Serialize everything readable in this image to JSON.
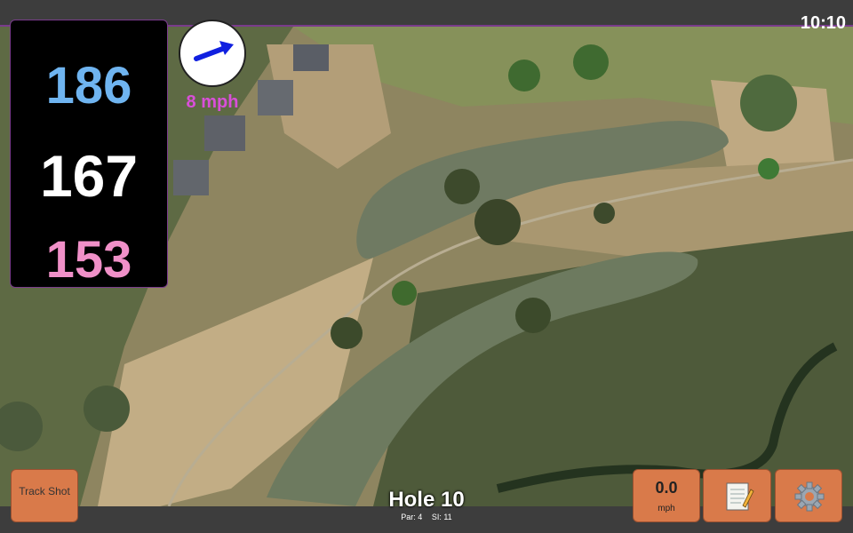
{
  "status": {
    "time": "10:10"
  },
  "distances": {
    "back": "186",
    "middle": "167",
    "front": "153"
  },
  "wind": {
    "speed_label": "8 mph",
    "icon": "wind-arrow-icon"
  },
  "buttons": {
    "track_shot": "Track Shot",
    "speed_value": "0.0",
    "speed_unit": "mph",
    "notes_icon": "notepad-icon",
    "settings_icon": "gear-icon"
  },
  "hole": {
    "title": "Hole 10",
    "par": "Par: 4",
    "stroke_index": "SI: 11"
  },
  "colors": {
    "back": "#6fb4f0",
    "middle": "#ffffff",
    "front": "#f090c8",
    "button": "#d97a4a",
    "accent": "#7a3b8c"
  }
}
